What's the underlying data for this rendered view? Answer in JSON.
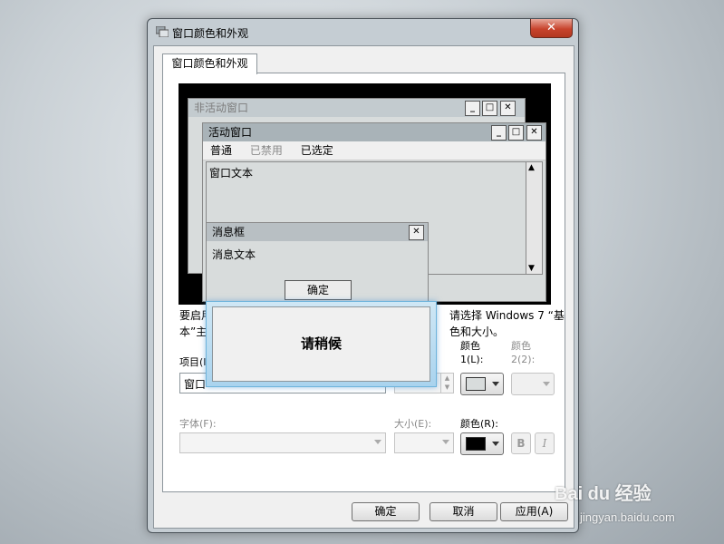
{
  "dialog": {
    "title": "窗口颜色和外观",
    "close_symbol": "✕",
    "tab_label": "窗口颜色和外观"
  },
  "preview": {
    "inactive_title": "非活动窗口",
    "active_title": "活动窗口",
    "menu": {
      "normal": "普通",
      "disabled": "已禁用",
      "selected": "已选定"
    },
    "window_text": "窗口文本",
    "msgbox_title": "消息框",
    "msgbox_text": "消息文本",
    "msgbox_ok": "确定",
    "min_symbol": "_",
    "max_symbol": "□",
    "close_symbol": "✕",
    "scroll_up": "▲",
    "scroll_down": "▼"
  },
  "info_text": {
    "line1_left": "要启用",
    "line1_right": "请选择 Windows 7 “基",
    "line2_left": "本”主",
    "line2_right": "色和大小。"
  },
  "wait_dialog": {
    "text": "请稍候"
  },
  "controls": {
    "item_label": "项目(I)",
    "item_value": "窗口",
    "color1_label_a": "颜色",
    "color1_label_b": "1(L):",
    "color2_label_a": "颜色",
    "color2_label_b": "2(2):",
    "font_label": "字体(F):",
    "size_label": "大小(E):",
    "color_label": "颜色(R):",
    "bold_label": "B",
    "italic_label": "I",
    "color1_swatch": "#d8dcdc",
    "font_color_swatch": "#000000"
  },
  "buttons": {
    "ok": "确定",
    "cancel": "取消",
    "apply": "应用(A)"
  },
  "watermark": {
    "brand": "Bai du 经验",
    "url": "jingyan.baidu.com"
  }
}
